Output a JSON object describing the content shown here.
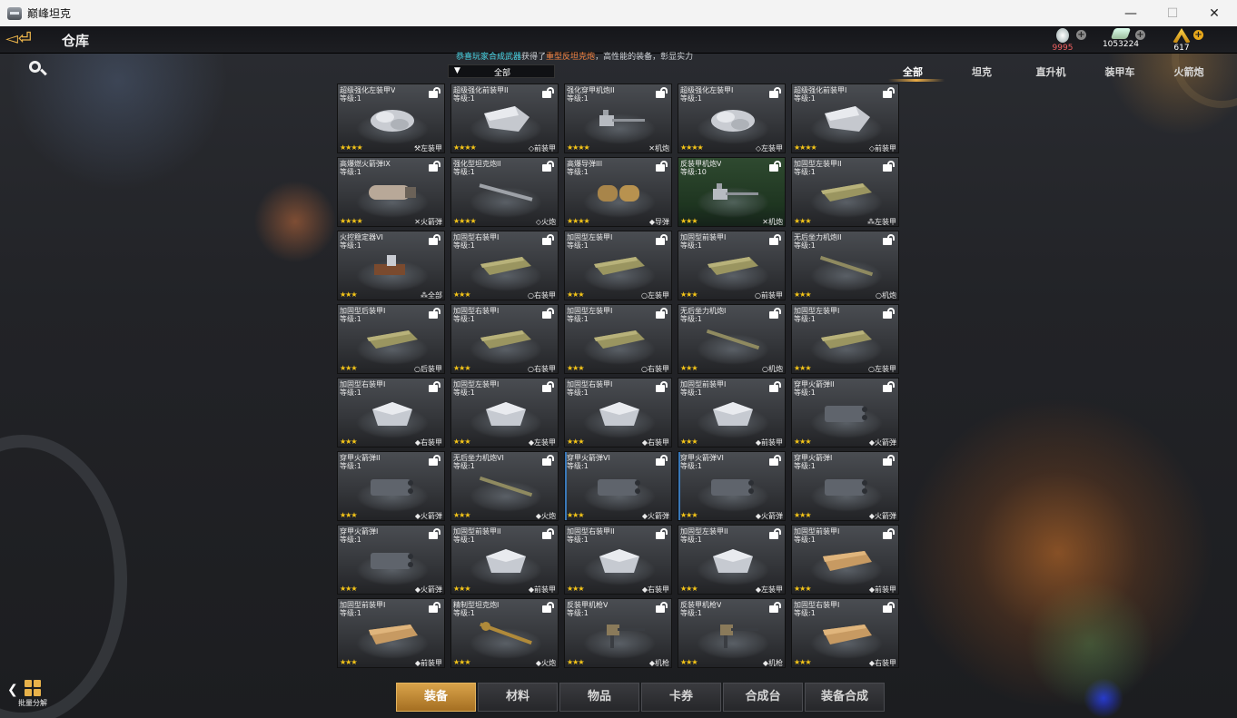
{
  "window": {
    "title": "巅峰坦克",
    "minimize": "—",
    "maximize": "☐",
    "close": "✕"
  },
  "header": {
    "back": "◅⏎",
    "title": "仓库"
  },
  "currencies": [
    {
      "name": "medal",
      "value": "9995"
    },
    {
      "name": "cash",
      "value": "1053224"
    },
    {
      "name": "gold",
      "value": "617"
    }
  ],
  "notice": {
    "part1": "恭喜玩家",
    "part2": "合成武器",
    "part3": "获得了",
    "part4": "重型反坦克炮",
    "part5": "，高性能的装备，彰显实力"
  },
  "filter": {
    "arrow": "▼",
    "label": "全部"
  },
  "tabs": [
    "全部",
    "坦克",
    "直升机",
    "装甲车",
    "火箭炮"
  ],
  "items": [
    {
      "name": "超级强化左装甲V",
      "level": "等级:1",
      "stars": "★★★★",
      "slot": "⚒左装甲",
      "icon": "armor-plates-icon"
    },
    {
      "name": "超级强化前装甲II",
      "level": "等级:1",
      "stars": "★★★★",
      "slot": "◇前装甲",
      "icon": "front-armor-icon"
    },
    {
      "name": "强化穿甲机炮II",
      "level": "等级:1",
      "stars": "★★★★",
      "slot": "✕机炮",
      "icon": "autocannon-icon"
    },
    {
      "name": "超级强化左装甲I",
      "level": "等级:1",
      "stars": "★★★★",
      "slot": "◇左装甲",
      "icon": "armor-plates-icon"
    },
    {
      "name": "超级强化前装甲I",
      "level": "等级:1",
      "stars": "★★★★",
      "slot": "◇前装甲",
      "icon": "front-armor-icon"
    },
    {
      "name": "高爆燃火箭弹IX",
      "level": "等级:1",
      "stars": "★★★★",
      "slot": "✕火箭弹",
      "icon": "rocket-shell-icon"
    },
    {
      "name": "强化型坦克炮II",
      "level": "等级:1",
      "stars": "★★★★",
      "slot": "◇火炮",
      "icon": "tank-barrel-icon"
    },
    {
      "name": "高爆导弹III",
      "level": "等级:1",
      "stars": "★★★★",
      "slot": "◆导弹",
      "icon": "missile-pod-icon"
    },
    {
      "name": "反装甲机炮V",
      "level": "等级:10",
      "stars": "★★★",
      "slot": "✕机炮",
      "icon": "autocannon-icon"
    },
    {
      "name": "加固型左装甲II",
      "level": "等级:1",
      "stars": "★★★",
      "slot": "⁂左装甲",
      "icon": "plate-armor-icon"
    },
    {
      "name": "火控稳定器VI",
      "level": "等级:1",
      "stars": "★★★",
      "slot": "⁂全部",
      "icon": "stabilizer-icon"
    },
    {
      "name": "加固型右装甲I",
      "level": "等级:1",
      "stars": "★★★",
      "slot": "○右装甲",
      "icon": "plate-armor-icon"
    },
    {
      "name": "加固型左装甲I",
      "level": "等级:1",
      "stars": "★★★",
      "slot": "○左装甲",
      "icon": "plate-armor-icon"
    },
    {
      "name": "加固型前装甲I",
      "level": "等级:1",
      "stars": "★★★",
      "slot": "○前装甲",
      "icon": "plate-armor-icon"
    },
    {
      "name": "无后坐力机炮II",
      "level": "等级:1",
      "stars": "★★★",
      "slot": "○机炮",
      "icon": "recoilless-gun-icon"
    },
    {
      "name": "加固型后装甲I",
      "level": "等级:1",
      "stars": "★★★",
      "slot": "○后装甲",
      "icon": "plate-armor-icon"
    },
    {
      "name": "加固型右装甲I",
      "level": "等级:1",
      "stars": "★★★",
      "slot": "○右装甲",
      "icon": "plate-armor-icon"
    },
    {
      "name": "加固型左装甲I",
      "level": "等级:1",
      "stars": "★★★",
      "slot": "○右装甲",
      "icon": "plate-armor-icon"
    },
    {
      "name": "无后坐力机炮I",
      "level": "等级:1",
      "stars": "★★★",
      "slot": "○机炮",
      "icon": "recoilless-gun-icon"
    },
    {
      "name": "加固型左装甲I",
      "level": "等级:1",
      "stars": "★★★",
      "slot": "○左装甲",
      "icon": "plate-armor-icon"
    },
    {
      "name": "加固型右装甲I",
      "level": "等级:1",
      "stars": "★★★",
      "slot": "◆右装甲",
      "icon": "steel-armor-icon"
    },
    {
      "name": "加固型左装甲I",
      "level": "等级:1",
      "stars": "★★★",
      "slot": "◆左装甲",
      "icon": "steel-armor-icon"
    },
    {
      "name": "加固型右装甲I",
      "level": "等级:1",
      "stars": "★★★",
      "slot": "◆右装甲",
      "icon": "steel-armor-icon"
    },
    {
      "name": "加固型前装甲I",
      "level": "等级:1",
      "stars": "★★★",
      "slot": "◆前装甲",
      "icon": "steel-armor-icon"
    },
    {
      "name": "穿甲火箭弹II",
      "level": "等级:1",
      "stars": "★★★",
      "slot": "◆火箭弹",
      "icon": "rocket-launcher-icon"
    },
    {
      "name": "穿甲火箭弹II",
      "level": "等级:1",
      "stars": "★★★",
      "slot": "◆火箭弹",
      "icon": "rocket-launcher-icon"
    },
    {
      "name": "无后坐力机炮VI",
      "level": "等级:1",
      "stars": "★★★",
      "slot": "◆火炮",
      "icon": "recoilless-gun-icon"
    },
    {
      "name": "穿甲火箭弹VI",
      "level": "等级:1",
      "stars": "★★★",
      "slot": "◆火箭弹",
      "icon": "rocket-launcher-icon"
    },
    {
      "name": "穿甲火箭弹VI",
      "level": "等级:1",
      "stars": "★★★",
      "slot": "◆火箭弹",
      "icon": "rocket-launcher-icon"
    },
    {
      "name": "穿甲火箭弹I",
      "level": "等级:1",
      "stars": "★★★",
      "slot": "◆火箭弹",
      "icon": "rocket-launcher-icon"
    },
    {
      "name": "穿甲火箭弹I",
      "level": "等级:1",
      "stars": "★★★",
      "slot": "◆火箭弹",
      "icon": "rocket-launcher-icon"
    },
    {
      "name": "加固型前装甲II",
      "level": "等级:1",
      "stars": "★★★",
      "slot": "◆前装甲",
      "icon": "steel-armor-icon"
    },
    {
      "name": "加固型右装甲II",
      "level": "等级:1",
      "stars": "★★★",
      "slot": "◆右装甲",
      "icon": "steel-armor-icon"
    },
    {
      "name": "加固型左装甲II",
      "level": "等级:1",
      "stars": "★★★",
      "slot": "◆左装甲",
      "icon": "steel-armor-icon"
    },
    {
      "name": "加固型前装甲I",
      "level": "等级:1",
      "stars": "★★★",
      "slot": "◆前装甲",
      "icon": "bronze-armor-icon"
    },
    {
      "name": "加固型前装甲I",
      "level": "等级:1",
      "stars": "★★★",
      "slot": "◆前装甲",
      "icon": "bronze-armor-icon"
    },
    {
      "name": "精制型坦克炮I",
      "level": "等级:1",
      "stars": "★★★",
      "slot": "◆火炮",
      "icon": "bronze-barrel-icon"
    },
    {
      "name": "反装甲机枪V",
      "level": "等级:1",
      "stars": "★★★",
      "slot": "◆机枪",
      "icon": "machine-gun-icon"
    },
    {
      "name": "反装甲机枪V",
      "level": "等级:1",
      "stars": "★★★",
      "slot": "◆机枪",
      "icon": "machine-gun-icon"
    },
    {
      "name": "加固型右装甲I",
      "level": "等级:1",
      "stars": "★★★",
      "slot": "◆右装甲",
      "icon": "bronze-armor-icon"
    }
  ],
  "bottom_tabs": [
    "装备",
    "材料",
    "物品",
    "卡券",
    "合成台",
    "装备合成"
  ],
  "batch": {
    "arrow": "❮",
    "label": "批量分解"
  },
  "colors": {
    "accent": "#e8aa46",
    "star": "#f5c518",
    "notice_cyan": "#49d6e6",
    "notice_orange": "#f08040"
  }
}
